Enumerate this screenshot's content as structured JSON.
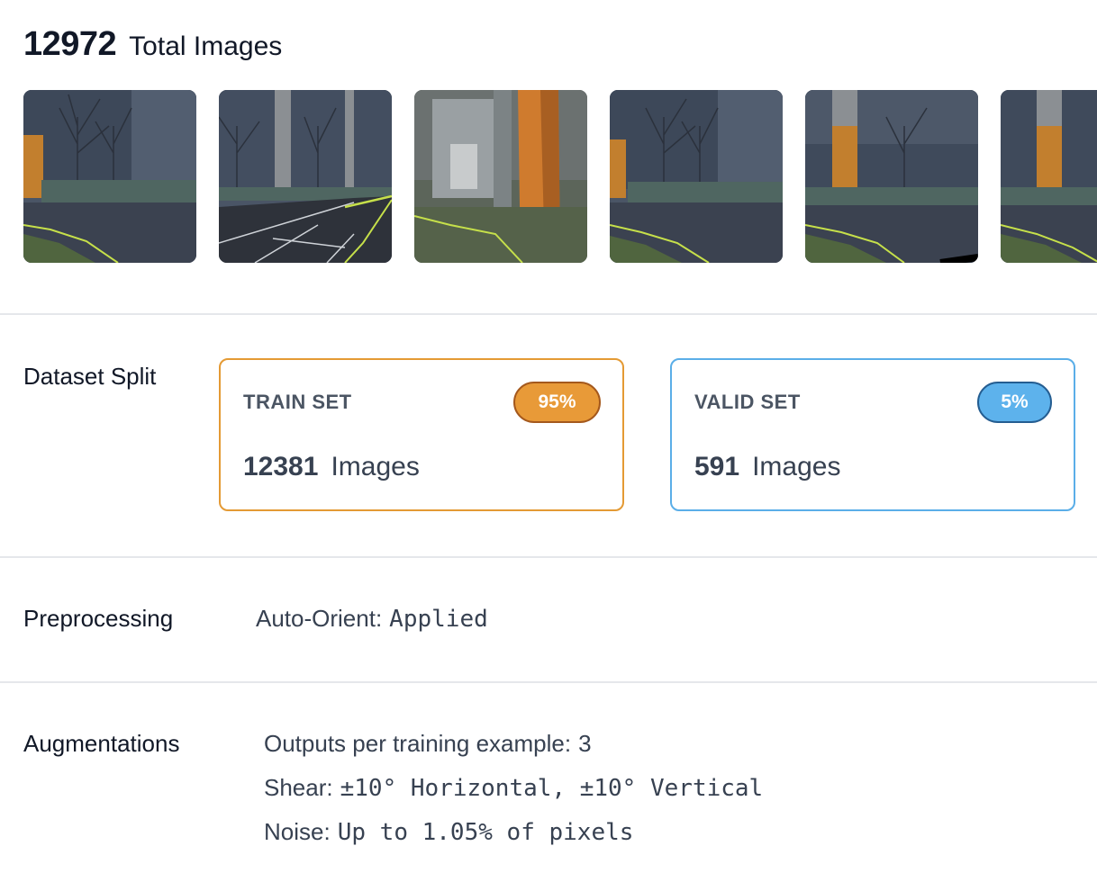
{
  "header": {
    "total_count": "12972",
    "total_label": "Total Images"
  },
  "thumbnails": [
    {
      "name": "thumbnail-1",
      "scene": "campus-road-trees"
    },
    {
      "name": "thumbnail-2",
      "scene": "campus-court-lines"
    },
    {
      "name": "thumbnail-3",
      "scene": "building-lobby-pillar"
    },
    {
      "name": "thumbnail-4",
      "scene": "campus-road-trees"
    },
    {
      "name": "thumbnail-5",
      "scene": "campus-road-trees"
    },
    {
      "name": "thumbnail-6",
      "scene": "campus-road-trees"
    }
  ],
  "dataset_split": {
    "label": "Dataset Split",
    "train": {
      "title": "TRAIN SET",
      "percent": "95%",
      "count": "12381",
      "unit": "Images",
      "color": "#e49a34"
    },
    "valid": {
      "title": "VALID SET",
      "percent": "5%",
      "count": "591",
      "unit": "Images",
      "color": "#5aaee8"
    }
  },
  "preprocessing": {
    "label": "Preprocessing",
    "items": [
      {
        "key": "Auto-Orient:",
        "value": "Applied"
      }
    ]
  },
  "augmentations": {
    "label": "Augmentations",
    "items": [
      {
        "key": "Outputs per training example:",
        "value": "3"
      },
      {
        "key": "Shear:",
        "value": "±10° Horizontal, ±10° Vertical"
      },
      {
        "key": "Noise:",
        "value": "Up to 1.05% of pixels"
      }
    ]
  }
}
